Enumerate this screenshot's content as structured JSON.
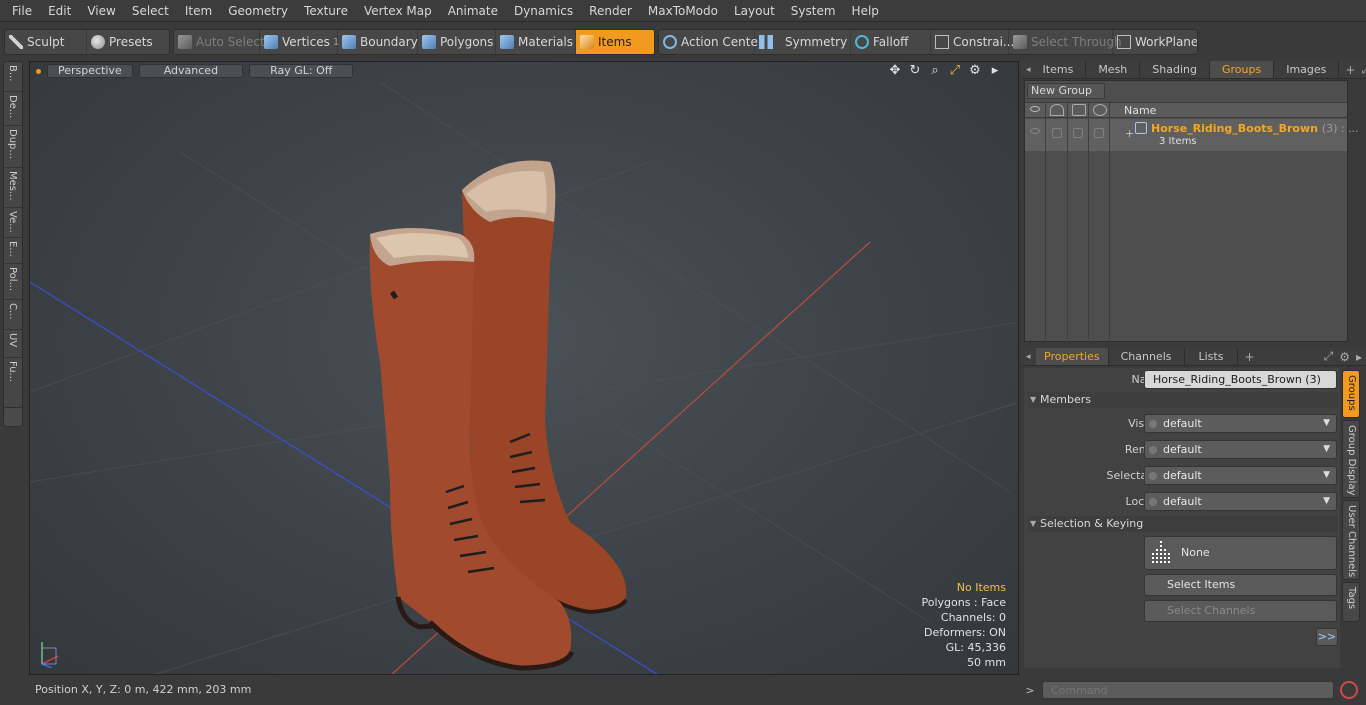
{
  "menu": [
    "File",
    "Edit",
    "View",
    "Select",
    "Item",
    "Geometry",
    "Texture",
    "Vertex Map",
    "Animate",
    "Dynamics",
    "Render",
    "MaxToModo",
    "Layout",
    "System",
    "Help"
  ],
  "toolbar": {
    "sculpt": "Sculpt",
    "presets": "Presets",
    "auto_select": "Auto Select",
    "vertices": "Vertices",
    "vertices_count": "1",
    "boundary": "Boundary",
    "polygons": "Polygons",
    "materials": "Materials",
    "items": "Items",
    "action_center": "Action Center",
    "symmetry": "Symmetry",
    "falloff": "Falloff",
    "constraints": "Constrai...",
    "select_through": "Select Through",
    "workplane": "WorkPlane"
  },
  "left_tabs": [
    "B...",
    "De...",
    "Dup...",
    "Mes...",
    "Ve...",
    "E...",
    "Pol...",
    "C...",
    "UV",
    "Fu..."
  ],
  "viewport": {
    "view_mode": "Perspective",
    "shading": "Advanced",
    "raygl": "Ray GL: Off",
    "info": {
      "selection": "No Items",
      "polygons": "Polygons : Face",
      "channels": "Channels: 0",
      "deformers": "Deformers: ON",
      "gl": "GL: 45,336",
      "scale": "50 mm"
    }
  },
  "status": {
    "position": "Position X, Y, Z:   0 m, 422 mm, 203 mm"
  },
  "right_tabs": [
    "Items",
    "Mesh ...",
    "Shading",
    "Groups",
    "Images"
  ],
  "right_active": "Groups",
  "groups": {
    "new_group": "New Group",
    "name_header": "Name",
    "row": {
      "name": "Horse_Riding_Boots_Brown",
      "count": "(3) : ...",
      "sub": "3 Items"
    }
  },
  "prop_tabs": [
    "Properties",
    "Channels",
    "Lists"
  ],
  "properties": {
    "name_label": "Name",
    "name_value": "Horse_Riding_Boots_Brown (3)",
    "members_section": "Members",
    "visible_label": "Visible",
    "visible_value": "default",
    "render_label": "Render",
    "render_value": "default",
    "selectable_label": "Selectable",
    "selectable_value": "default",
    "locked_label": "Locked",
    "locked_value": "default",
    "keying_section": "Selection & Keying",
    "none_label": "None",
    "select_items": "Select Items",
    "select_channels": "Select Channels",
    "more": ">>"
  },
  "right_vtabs": [
    "Groups",
    "Group Display",
    "User Channels",
    "Tags"
  ],
  "command": {
    "placeholder": "Command",
    "prompt": ">"
  },
  "colors": {
    "accent": "#f19a1e",
    "boot": "#a0482c"
  }
}
